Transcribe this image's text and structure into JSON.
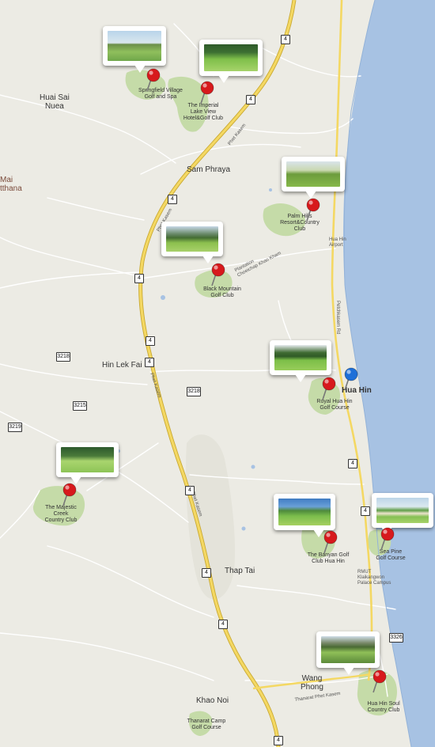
{
  "colors": {
    "land": "#ecebe4",
    "sea": "#a7c2e3",
    "park": "#c5dba8",
    "highway": "#f4d863",
    "highwayEdge": "#c9a932",
    "road": "#ffffff",
    "pinRed": "#d7191c",
    "pinBlue": "#1e6fd8"
  },
  "places": [
    {
      "id": "huai-sai-nuea",
      "text": "Huai Sai\nNuea"
    },
    {
      "id": "mai-tthana",
      "text": "Mai\ntthana"
    },
    {
      "id": "sam-phraya",
      "text": "Sam Phraya"
    },
    {
      "id": "hin-lek-fai",
      "text": "Hin Lek Fai"
    },
    {
      "id": "thap-tai",
      "text": "Thap Tai"
    },
    {
      "id": "wang-phong",
      "text": "Wang\nPhong"
    },
    {
      "id": "khao-noi",
      "text": "Khao Noi"
    },
    {
      "id": "hua-hin",
      "text": "Hua Hin"
    }
  ],
  "small_labels": [
    {
      "id": "hua-hin-airport",
      "text": "Hua Hin\nAirport"
    },
    {
      "id": "rmut-campus",
      "text": "RMUT\nKlaikangwon\nPalace Campus"
    },
    {
      "id": "plantation",
      "text": "Plantation\nChoeichap Khao Kham"
    }
  ],
  "roads": [
    {
      "id": "phet-kasem-1",
      "text": "Phet Kasem"
    },
    {
      "id": "phet-kasem-2",
      "text": "Phet Kasem"
    },
    {
      "id": "phet-kasem-3",
      "text": "Phet Kasem"
    },
    {
      "id": "phet-kasem-4",
      "text": "Phet Kasem"
    },
    {
      "id": "thanarat-phet-kasem",
      "text": "Thanarat Phet Kasem"
    },
    {
      "id": "petchkasem-rd",
      "text": "Petchkasem Rd"
    }
  ],
  "shields": [
    {
      "id": "s4-a",
      "text": "4"
    },
    {
      "id": "s4-b",
      "text": "4"
    },
    {
      "id": "s4-c",
      "text": "4"
    },
    {
      "id": "s4-d",
      "text": "4"
    },
    {
      "id": "s4-e",
      "text": "4"
    },
    {
      "id": "s4-f",
      "text": "4"
    },
    {
      "id": "s4-g",
      "text": "4"
    },
    {
      "id": "s4-h",
      "text": "4"
    },
    {
      "id": "s4-i",
      "text": "4"
    },
    {
      "id": "s4-j",
      "text": "4"
    },
    {
      "id": "s4-k",
      "text": "4"
    },
    {
      "id": "s4-l",
      "text": "4"
    },
    {
      "id": "s4-m",
      "text": "4"
    },
    {
      "id": "s4-n",
      "text": "4"
    },
    {
      "id": "s3218",
      "text": "3218"
    },
    {
      "id": "s3215",
      "text": "3215"
    },
    {
      "id": "s3219",
      "text": "3219"
    },
    {
      "id": "s3218b",
      "text": "3218"
    },
    {
      "id": "s3326",
      "text": "3326"
    }
  ],
  "golf_courses": [
    {
      "id": "springfield",
      "name": "Springfield Village\nGolf and Spa",
      "photo": "fairway-flags"
    },
    {
      "id": "imperial",
      "name": "The Imperial\nLake View\nHotel&Golf Club",
      "photo": "green-trees"
    },
    {
      "id": "palm-hills",
      "name": "Palm Hills\nResort&Country\nClub",
      "photo": "hill-fairway"
    },
    {
      "id": "black-mountain",
      "name": "Black Mountain\nGolf Club",
      "photo": "mountain-fairway"
    },
    {
      "id": "royal-hua-hin",
      "name": "Royal Hua Hin\nGolf Course",
      "photo": "tree-fairway"
    },
    {
      "id": "majestic-creek",
      "name": "The Majestic\nCreek\nCountry Club",
      "photo": "wide-fairway"
    },
    {
      "id": "banyan",
      "name": "The Banyan Golf\nClub Hua Hin",
      "photo": "sky-green"
    },
    {
      "id": "sea-pine",
      "name": "Sea Pine\nGolf Course",
      "photo": "bunker-sea"
    },
    {
      "id": "hua-hin-soul",
      "name": "Hua Hin Soul\nCountry Club",
      "photo": "valley"
    },
    {
      "id": "thanarat",
      "name": "Thanarat Camp\nGolf Course",
      "photo": ""
    }
  ]
}
